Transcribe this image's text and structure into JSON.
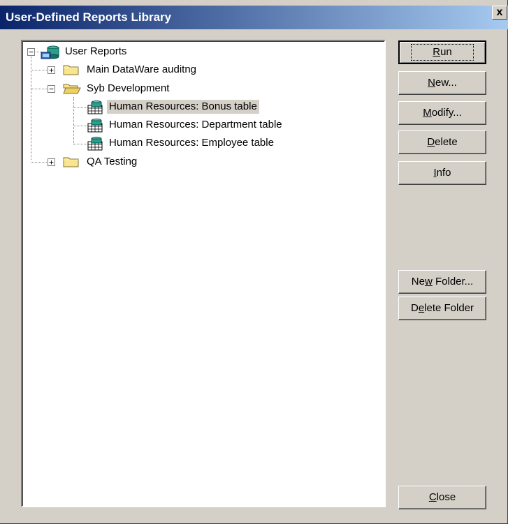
{
  "window": {
    "title": "User-Defined Reports Library",
    "close_glyph": "x"
  },
  "tree": {
    "root": {
      "label": "User Reports",
      "expander": "−",
      "icon": "database-icon"
    },
    "children": [
      {
        "label": "Main DataWare auditng",
        "expander": "+",
        "icon": "folder-closed-icon"
      },
      {
        "label": "Syb Development",
        "expander": "−",
        "icon": "folder-open-icon",
        "children": [
          {
            "label": "Human Resources: Bonus table",
            "icon": "report-icon",
            "selected": true
          },
          {
            "label": "Human Resources: Department table",
            "icon": "report-icon"
          },
          {
            "label": "Human Resources: Employee table",
            "icon": "report-icon"
          }
        ]
      },
      {
        "label": "QA Testing",
        "expander": "+",
        "icon": "folder-closed-icon"
      }
    ]
  },
  "buttons": {
    "run": {
      "pre": "",
      "key": "R",
      "post": "un"
    },
    "new": {
      "pre": "",
      "key": "N",
      "post": "ew..."
    },
    "modify": {
      "pre": "",
      "key": "M",
      "post": "odify..."
    },
    "delete": {
      "pre": "",
      "key": "D",
      "post": "elete"
    },
    "info": {
      "pre": "",
      "key": "I",
      "post": "nfo"
    },
    "new_folder": {
      "pre": "Ne",
      "key": "w",
      "post": " Folder..."
    },
    "delete_folder": {
      "pre": "D",
      "key": "e",
      "post": "lete Folder"
    },
    "close": {
      "pre": "",
      "key": "C",
      "post": "lose"
    }
  },
  "colors": {
    "titlebar_start": "#0a246a",
    "titlebar_end": "#a6caf0",
    "dialog_face": "#d4d0c8",
    "selection": "#d4d0c8"
  }
}
